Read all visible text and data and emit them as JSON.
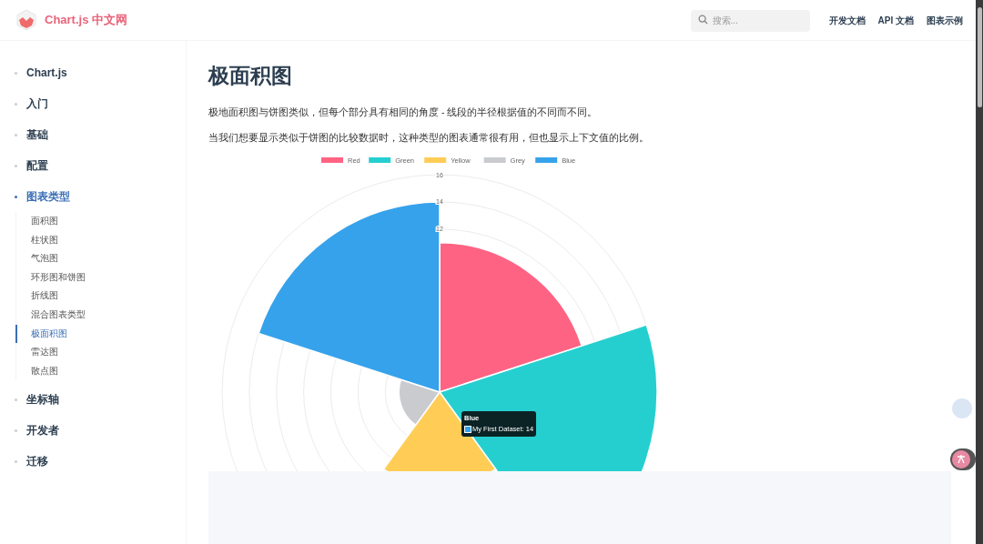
{
  "header": {
    "brand": "Chart.js 中文网",
    "search": {
      "placeholder": "搜索..."
    },
    "nav": [
      "开发文档",
      "API 文档",
      "图表示例"
    ]
  },
  "sidebar": {
    "items": [
      {
        "label": "Chart.js",
        "selected": false
      },
      {
        "label": "入门",
        "selected": false
      },
      {
        "label": "基础",
        "selected": false
      },
      {
        "label": "配置",
        "selected": false
      },
      {
        "label": "图表类型",
        "selected": true,
        "children": [
          {
            "label": "面积图",
            "selected": false
          },
          {
            "label": "柱状图",
            "selected": false
          },
          {
            "label": "气泡图",
            "selected": false
          },
          {
            "label": "环形图和饼图",
            "selected": false
          },
          {
            "label": "折线图",
            "selected": false
          },
          {
            "label": "混合图表类型",
            "selected": false
          },
          {
            "label": "极面积图",
            "selected": true
          },
          {
            "label": "雷达图",
            "selected": false
          },
          {
            "label": "散点图",
            "selected": false
          }
        ]
      },
      {
        "label": "坐标轴",
        "selected": false
      },
      {
        "label": "开发者",
        "selected": false
      },
      {
        "label": "迁移",
        "selected": false
      }
    ]
  },
  "content": {
    "title": "极面积图",
    "paragraphs": [
      "极地面积图与饼图类似，但每个部分具有相同的角度 - 线段的半径根据值的不同而不同。",
      "当我们想要显示类似于饼图的比较数据时，这种类型的图表通常很有用，但也显示上下文值的比例。"
    ],
    "chart": {
      "legend": [
        {
          "label": "Red",
          "color": "#ff6384"
        },
        {
          "label": "Green",
          "color": "#26cfcf"
        },
        {
          "label": "Yellow",
          "color": "#ffcd56"
        },
        {
          "label": "Grey",
          "color": "#c9cbcf"
        },
        {
          "label": "Blue",
          "color": "#36a2eb"
        }
      ],
      "ticks": [
        "16",
        "14",
        "12"
      ],
      "tooltip": {
        "title": "Blue",
        "label": "My First Dataset: 14",
        "color": "#36a2eb"
      }
    }
  }
}
